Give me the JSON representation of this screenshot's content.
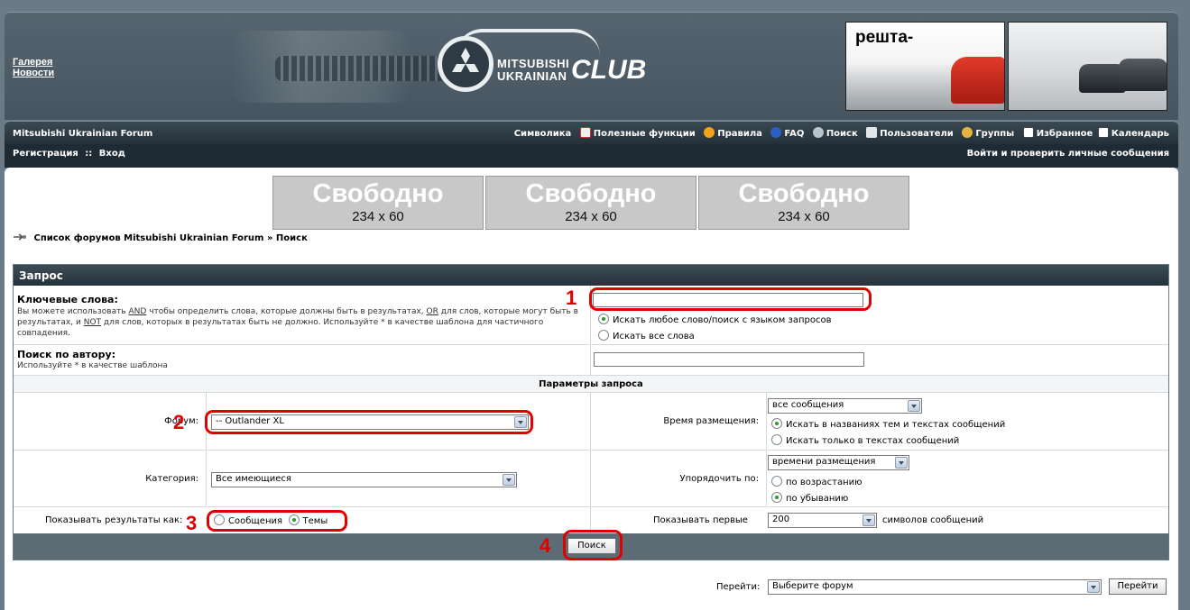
{
  "header": {
    "links": [
      "Галерея",
      "Новости"
    ],
    "logo": {
      "line1": "MITSUBISHI",
      "line2": "UKRAINIAN",
      "club": "CLUB"
    },
    "banner_a_text": "решта-"
  },
  "navbar": {
    "forum_title": "Mitsubishi Ukrainian Forum",
    "items": [
      "Символика",
      "Полезные функции",
      "Правила",
      "FAQ",
      "Поиск",
      "Пользователи",
      "Группы",
      "Избранное",
      "Календарь"
    ],
    "register": "Регистрация",
    "separator": "::",
    "login": "Вход",
    "login_check": "Войти и проверить личные сообщения"
  },
  "ads": [
    {
      "title": "Свободно",
      "size": "234 x 60"
    },
    {
      "title": "Свободно",
      "size": "234 x 60"
    },
    {
      "title": "Свободно",
      "size": "234 x 60"
    }
  ],
  "breadcrumb": {
    "forum_list": "Список форумов Mitsubishi Ukrainian Forum",
    "sep": "»",
    "current": "Поиск"
  },
  "search": {
    "header": "Запрос",
    "keywords_label": "Ключевые слова:",
    "keywords_hint_1": "Вы можете использовать",
    "and": "AND",
    "keywords_hint_2": "чтобы определить слова, которые должны быть в результатах,",
    "or": "OR",
    "keywords_hint_3": "для слов, которые могут быть в результатах, и",
    "not": "NOT",
    "keywords_hint_4": "для слов, которых в результатах быть не должно. Используйте * в качестве шаблона для частичного совпадения.",
    "keywords_value": "",
    "kw_opt_any": "Искать любое слово/поиск с языком запросов",
    "kw_opt_all": "Искать все слова",
    "author_label": "Поиск по автору:",
    "author_hint": "Используйте * в качестве шаблона",
    "author_value": "",
    "params_title": "Параметры запроса",
    "forum_label": "Форум:",
    "forum_value": "-- Outlander XL",
    "time_label": "Время размещения:",
    "time_value": "все сообщения",
    "time_opt_1": "Искать в названиях тем и текстах сообщений",
    "time_opt_2": "Искать только в текстах сообщений",
    "category_label": "Категория:",
    "category_value": "Все имеющиеся",
    "sort_label": "Упорядочить по:",
    "sort_value": "времени размещения",
    "sort_opt_asc": "по возрастанию",
    "sort_opt_desc": "по убыванию",
    "show_as_label": "Показывать результаты как:",
    "show_opt_posts": "Сообщения",
    "show_opt_topics": "Темы",
    "show_first_label": "Показывать первые",
    "show_first_value": "200",
    "chars_label": "символов сообщений",
    "submit": "Поиск"
  },
  "jump": {
    "label": "Перейти:",
    "value": "Выберите форум",
    "button": "Перейти"
  },
  "annotations": [
    "1",
    "2",
    "3",
    "4"
  ],
  "colors": {
    "accent_red": "#e00000",
    "header_bg": "#25323b",
    "page_bg": "#6a7a86"
  }
}
